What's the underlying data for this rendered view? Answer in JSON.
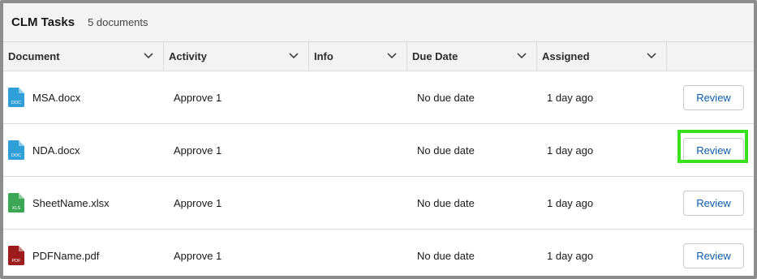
{
  "header": {
    "title": "CLM Tasks",
    "count": "5 documents"
  },
  "columns": [
    {
      "label": "Document"
    },
    {
      "label": "Activity"
    },
    {
      "label": "Info"
    },
    {
      "label": "Due Date"
    },
    {
      "label": "Assigned"
    }
  ],
  "rows": [
    {
      "document": "MSA.docx",
      "file_type": "DOC",
      "icon_color": "#2f9fd8",
      "activity": "Approve 1",
      "info": "",
      "due_date": "No due date",
      "assigned": "1 day ago",
      "action": "Review"
    },
    {
      "document": "NDA.docx",
      "file_type": "DOC",
      "icon_color": "#2f9fd8",
      "activity": "Approve 1",
      "info": "",
      "due_date": "No due date",
      "assigned": "1 day ago",
      "action": "Review"
    },
    {
      "document": "SheetName.xlsx",
      "file_type": "XLS",
      "icon_color": "#3ba755",
      "activity": "Approve 1",
      "info": "",
      "due_date": "No due date",
      "assigned": "1 day ago",
      "action": "Review"
    },
    {
      "document": "PDFName.pdf",
      "file_type": "PDF",
      "icon_color": "#9e1b1b",
      "activity": "Approve 1",
      "info": "",
      "due_date": "No due date",
      "assigned": "1 day ago",
      "action": "Review"
    }
  ],
  "highlighted_row_index": 1,
  "colors": {
    "highlight": "#39e01c",
    "link": "#0b5cab",
    "header_bg": "#f3f3f3"
  }
}
